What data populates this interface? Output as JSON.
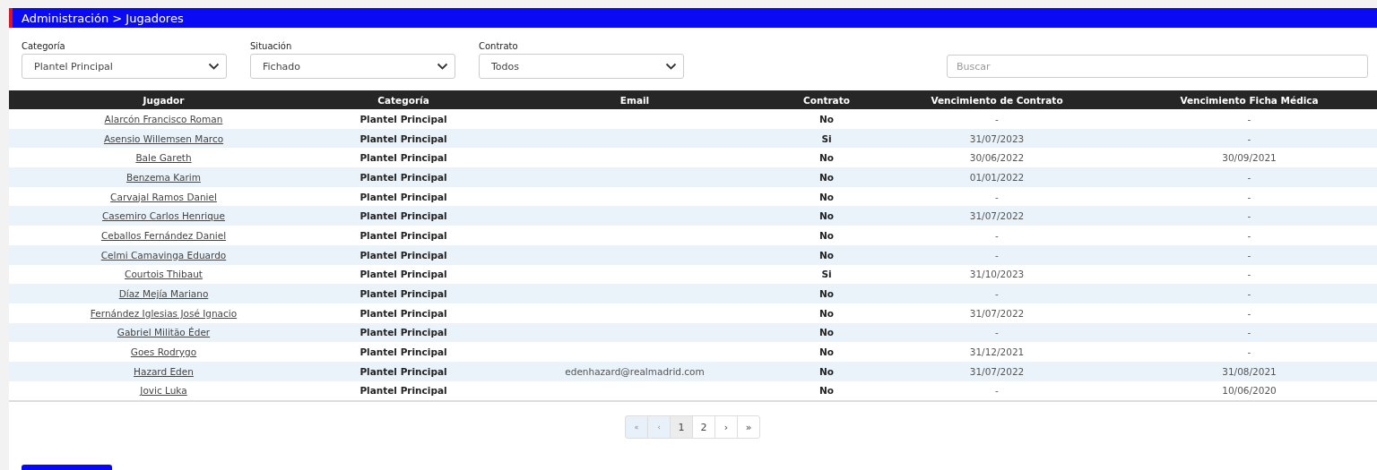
{
  "header": {
    "title": "Administración > Jugadores"
  },
  "filters": [
    {
      "label": "Categoría",
      "value": "Plantel Principal"
    },
    {
      "label": "Situación",
      "value": "Fichado"
    },
    {
      "label": "Contrato",
      "value": "Todos"
    }
  ],
  "search": {
    "placeholder": "Buscar"
  },
  "table": {
    "columns": [
      "Jugador",
      "Categoría",
      "Email",
      "Contrato",
      "Vencimiento de Contrato",
      "Vencimiento Ficha Médica"
    ],
    "rows": [
      {
        "jugador": "Alarcón Francisco Roman",
        "categoria": "Plantel Principal",
        "contrato": "No",
        "vencimiento_contrato": "-",
        "vencimiento_ficha": "-"
      },
      {
        "jugador": "Asensio Willemsen Marco",
        "categoria": "Plantel Principal",
        "contrato": "Si",
        "vencimiento_contrato": "31/07/2023",
        "vencimiento_ficha": "-"
      },
      {
        "jugador": "Bale Gareth",
        "categoria": "Plantel Principal",
        "contrato": "No",
        "vencimiento_contrato": "30/06/2022",
        "vencimiento_ficha": "30/09/2021"
      },
      {
        "jugador": "Benzema Karim",
        "categoria": "Plantel Principal",
        "contrato": "No",
        "vencimiento_contrato": "01/01/2022",
        "vencimiento_ficha": "-"
      },
      {
        "jugador": "Carvajal Ramos Daniel",
        "categoria": "Plantel Principal",
        "contrato": "No",
        "vencimiento_contrato": "-",
        "vencimiento_ficha": "-"
      },
      {
        "jugador": "Casemiro Carlos Henrique",
        "categoria": "Plantel Principal",
        "contrato": "No",
        "vencimiento_contrato": "31/07/2022",
        "vencimiento_ficha": "-"
      },
      {
        "jugador": "Ceballos Fernández Daniel",
        "categoria": "Plantel Principal",
        "contrato": "No",
        "vencimiento_contrato": "-",
        "vencimiento_ficha": "-"
      },
      {
        "jugador": "Celmi Camavinga Eduardo",
        "categoria": "Plantel Principal",
        "contrato": "No",
        "vencimiento_contrato": "-",
        "vencimiento_ficha": "-"
      },
      {
        "jugador": "Courtois Thibaut",
        "categoria": "Plantel Principal",
        "contrato": "Si",
        "vencimiento_contrato": "31/10/2023",
        "vencimiento_ficha": "-"
      },
      {
        "jugador": "Díaz Mejía Mariano",
        "categoria": "Plantel Principal",
        "contrato": "No",
        "vencimiento_contrato": "-",
        "vencimiento_ficha": "-"
      },
      {
        "jugador": "Fernández Iglesias José Ignacio",
        "categoria": "Plantel Principal",
        "contrato": "No",
        "vencimiento_contrato": "31/07/2022",
        "vencimiento_ficha": "-"
      },
      {
        "jugador": "Gabriel Militão Éder",
        "categoria": "Plantel Principal",
        "contrato": "No",
        "vencimiento_contrato": "-",
        "vencimiento_ficha": "-"
      },
      {
        "jugador": "Goes Rodrygo",
        "categoria": "Plantel Principal",
        "contrato": "No",
        "vencimiento_contrato": "31/12/2021",
        "vencimiento_ficha": "-"
      },
      {
        "jugador": "Hazard Eden",
        "categoria": "Plantel Principal",
        "email": "edenhazard@realmadrid.com",
        "contrato": "No",
        "vencimiento_contrato": "31/07/2022",
        "vencimiento_ficha": "31/08/2021"
      },
      {
        "jugador": "Jovic Luka",
        "categoria": "Plantel Principal",
        "contrato": "No",
        "vencimiento_contrato": "-",
        "vencimiento_ficha": "10/06/2020"
      }
    ]
  },
  "pagination": [
    {
      "label": "«",
      "selected": false,
      "disabled": true
    },
    {
      "label": "‹",
      "selected": false,
      "disabled": true
    },
    {
      "label": "1",
      "selected": true,
      "disabled": false
    },
    {
      "label": "2",
      "selected": false,
      "disabled": false
    },
    {
      "label": "›",
      "selected": false,
      "disabled": false
    },
    {
      "label": "»",
      "selected": false,
      "disabled": false
    }
  ]
}
